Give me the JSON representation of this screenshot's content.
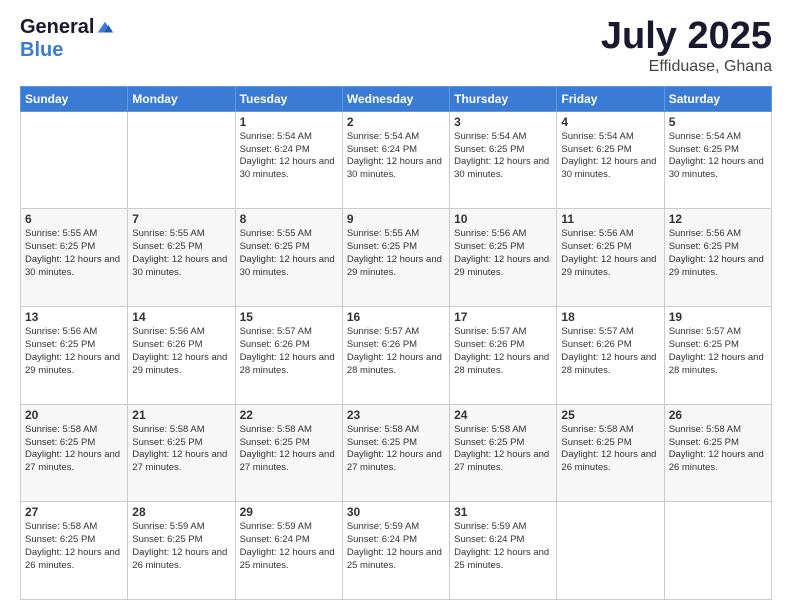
{
  "logo": {
    "general": "General",
    "blue": "Blue"
  },
  "title": {
    "month": "July 2025",
    "location": "Effiduase, Ghana"
  },
  "days": [
    "Sunday",
    "Monday",
    "Tuesday",
    "Wednesday",
    "Thursday",
    "Friday",
    "Saturday"
  ],
  "weeks": [
    [
      {
        "day": "",
        "info": ""
      },
      {
        "day": "",
        "info": ""
      },
      {
        "day": "1",
        "info": "Sunrise: 5:54 AM\nSunset: 6:24 PM\nDaylight: 12 hours and 30 minutes."
      },
      {
        "day": "2",
        "info": "Sunrise: 5:54 AM\nSunset: 6:24 PM\nDaylight: 12 hours and 30 minutes."
      },
      {
        "day": "3",
        "info": "Sunrise: 5:54 AM\nSunset: 6:25 PM\nDaylight: 12 hours and 30 minutes."
      },
      {
        "day": "4",
        "info": "Sunrise: 5:54 AM\nSunset: 6:25 PM\nDaylight: 12 hours and 30 minutes."
      },
      {
        "day": "5",
        "info": "Sunrise: 5:54 AM\nSunset: 6:25 PM\nDaylight: 12 hours and 30 minutes."
      }
    ],
    [
      {
        "day": "6",
        "info": "Sunrise: 5:55 AM\nSunset: 6:25 PM\nDaylight: 12 hours and 30 minutes."
      },
      {
        "day": "7",
        "info": "Sunrise: 5:55 AM\nSunset: 6:25 PM\nDaylight: 12 hours and 30 minutes."
      },
      {
        "day": "8",
        "info": "Sunrise: 5:55 AM\nSunset: 6:25 PM\nDaylight: 12 hours and 30 minutes."
      },
      {
        "day": "9",
        "info": "Sunrise: 5:55 AM\nSunset: 6:25 PM\nDaylight: 12 hours and 29 minutes."
      },
      {
        "day": "10",
        "info": "Sunrise: 5:56 AM\nSunset: 6:25 PM\nDaylight: 12 hours and 29 minutes."
      },
      {
        "day": "11",
        "info": "Sunrise: 5:56 AM\nSunset: 6:25 PM\nDaylight: 12 hours and 29 minutes."
      },
      {
        "day": "12",
        "info": "Sunrise: 5:56 AM\nSunset: 6:25 PM\nDaylight: 12 hours and 29 minutes."
      }
    ],
    [
      {
        "day": "13",
        "info": "Sunrise: 5:56 AM\nSunset: 6:25 PM\nDaylight: 12 hours and 29 minutes."
      },
      {
        "day": "14",
        "info": "Sunrise: 5:56 AM\nSunset: 6:26 PM\nDaylight: 12 hours and 29 minutes."
      },
      {
        "day": "15",
        "info": "Sunrise: 5:57 AM\nSunset: 6:26 PM\nDaylight: 12 hours and 28 minutes."
      },
      {
        "day": "16",
        "info": "Sunrise: 5:57 AM\nSunset: 6:26 PM\nDaylight: 12 hours and 28 minutes."
      },
      {
        "day": "17",
        "info": "Sunrise: 5:57 AM\nSunset: 6:26 PM\nDaylight: 12 hours and 28 minutes."
      },
      {
        "day": "18",
        "info": "Sunrise: 5:57 AM\nSunset: 6:26 PM\nDaylight: 12 hours and 28 minutes."
      },
      {
        "day": "19",
        "info": "Sunrise: 5:57 AM\nSunset: 6:25 PM\nDaylight: 12 hours and 28 minutes."
      }
    ],
    [
      {
        "day": "20",
        "info": "Sunrise: 5:58 AM\nSunset: 6:25 PM\nDaylight: 12 hours and 27 minutes."
      },
      {
        "day": "21",
        "info": "Sunrise: 5:58 AM\nSunset: 6:25 PM\nDaylight: 12 hours and 27 minutes."
      },
      {
        "day": "22",
        "info": "Sunrise: 5:58 AM\nSunset: 6:25 PM\nDaylight: 12 hours and 27 minutes."
      },
      {
        "day": "23",
        "info": "Sunrise: 5:58 AM\nSunset: 6:25 PM\nDaylight: 12 hours and 27 minutes."
      },
      {
        "day": "24",
        "info": "Sunrise: 5:58 AM\nSunset: 6:25 PM\nDaylight: 12 hours and 27 minutes."
      },
      {
        "day": "25",
        "info": "Sunrise: 5:58 AM\nSunset: 6:25 PM\nDaylight: 12 hours and 26 minutes."
      },
      {
        "day": "26",
        "info": "Sunrise: 5:58 AM\nSunset: 6:25 PM\nDaylight: 12 hours and 26 minutes."
      }
    ],
    [
      {
        "day": "27",
        "info": "Sunrise: 5:58 AM\nSunset: 6:25 PM\nDaylight: 12 hours and 26 minutes."
      },
      {
        "day": "28",
        "info": "Sunrise: 5:59 AM\nSunset: 6:25 PM\nDaylight: 12 hours and 26 minutes."
      },
      {
        "day": "29",
        "info": "Sunrise: 5:59 AM\nSunset: 6:24 PM\nDaylight: 12 hours and 25 minutes."
      },
      {
        "day": "30",
        "info": "Sunrise: 5:59 AM\nSunset: 6:24 PM\nDaylight: 12 hours and 25 minutes."
      },
      {
        "day": "31",
        "info": "Sunrise: 5:59 AM\nSunset: 6:24 PM\nDaylight: 12 hours and 25 minutes."
      },
      {
        "day": "",
        "info": ""
      },
      {
        "day": "",
        "info": ""
      }
    ]
  ]
}
